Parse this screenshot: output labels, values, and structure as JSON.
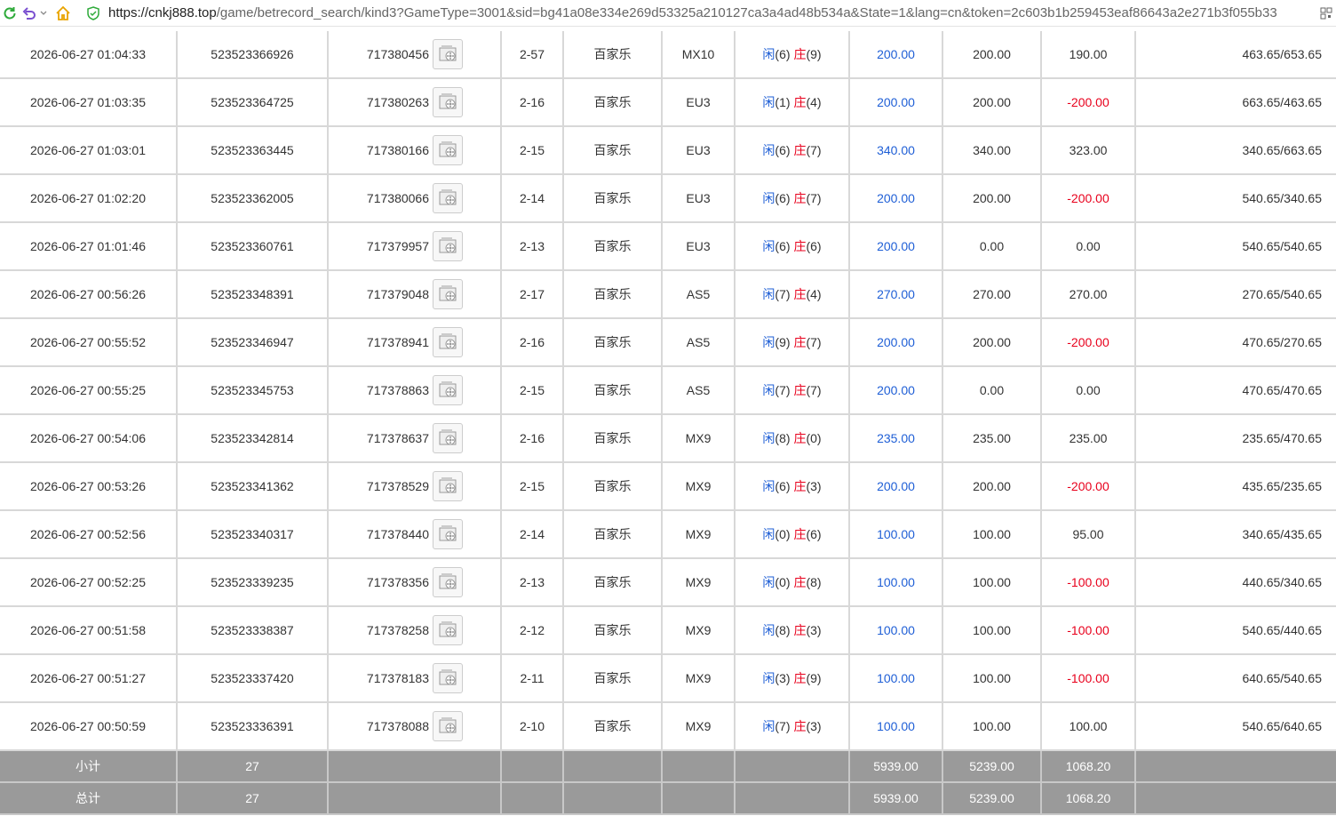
{
  "browser": {
    "url_host": "https://cnkj888.top",
    "url_path": "/game/betrecord_search/kind3?GameType=3001&sid=bg41a08e334e269d53325a210127ca3a4ad48b534a&State=1&lang=cn&token=2c603b1b259453eaf86643a2e271b3f055b33"
  },
  "rows": [
    {
      "time": "2026-06-27 01:04:33",
      "bet_id": "523523366926",
      "round": "717380456",
      "shoe": "2-57",
      "game": "百家乐",
      "table": "MX10",
      "player_label": "闲",
      "player_score": "(6)",
      "banker_label": "庄",
      "banker_score": "(9)",
      "bet": "200.00",
      "valid": "200.00",
      "win": "190.00",
      "win_color": "normal",
      "balance": "463.65/653.65"
    },
    {
      "time": "2026-06-27 01:03:35",
      "bet_id": "523523364725",
      "round": "717380263",
      "shoe": "2-16",
      "game": "百家乐",
      "table": "EU3",
      "player_label": "闲",
      "player_score": "(1)",
      "banker_label": "庄",
      "banker_score": "(4)",
      "bet": "200.00",
      "valid": "200.00",
      "win": "-200.00",
      "win_color": "red",
      "balance": "663.65/463.65"
    },
    {
      "time": "2026-06-27 01:03:01",
      "bet_id": "523523363445",
      "round": "717380166",
      "shoe": "2-15",
      "game": "百家乐",
      "table": "EU3",
      "player_label": "闲",
      "player_score": "(6)",
      "banker_label": "庄",
      "banker_score": "(7)",
      "bet": "340.00",
      "valid": "340.00",
      "win": "323.00",
      "win_color": "normal",
      "balance": "340.65/663.65"
    },
    {
      "time": "2026-06-27 01:02:20",
      "bet_id": "523523362005",
      "round": "717380066",
      "shoe": "2-14",
      "game": "百家乐",
      "table": "EU3",
      "player_label": "闲",
      "player_score": "(6)",
      "banker_label": "庄",
      "banker_score": "(7)",
      "bet": "200.00",
      "valid": "200.00",
      "win": "-200.00",
      "win_color": "red",
      "balance": "540.65/340.65"
    },
    {
      "time": "2026-06-27 01:01:46",
      "bet_id": "523523360761",
      "round": "717379957",
      "shoe": "2-13",
      "game": "百家乐",
      "table": "EU3",
      "player_label": "闲",
      "player_score": "(6)",
      "banker_label": "庄",
      "banker_score": "(6)",
      "bet": "200.00",
      "valid": "0.00",
      "win": "0.00",
      "win_color": "normal",
      "balance": "540.65/540.65"
    },
    {
      "time": "2026-06-27 00:56:26",
      "bet_id": "523523348391",
      "round": "717379048",
      "shoe": "2-17",
      "game": "百家乐",
      "table": "AS5",
      "player_label": "闲",
      "player_score": "(7)",
      "banker_label": "庄",
      "banker_score": "(4)",
      "bet": "270.00",
      "valid": "270.00",
      "win": "270.00",
      "win_color": "normal",
      "balance": "270.65/540.65"
    },
    {
      "time": "2026-06-27 00:55:52",
      "bet_id": "523523346947",
      "round": "717378941",
      "shoe": "2-16",
      "game": "百家乐",
      "table": "AS5",
      "player_label": "闲",
      "player_score": "(9)",
      "banker_label": "庄",
      "banker_score": "(7)",
      "bet": "200.00",
      "valid": "200.00",
      "win": "-200.00",
      "win_color": "red",
      "balance": "470.65/270.65"
    },
    {
      "time": "2026-06-27 00:55:25",
      "bet_id": "523523345753",
      "round": "717378863",
      "shoe": "2-15",
      "game": "百家乐",
      "table": "AS5",
      "player_label": "闲",
      "player_score": "(7)",
      "banker_label": "庄",
      "banker_score": "(7)",
      "bet": "200.00",
      "valid": "0.00",
      "win": "0.00",
      "win_color": "normal",
      "balance": "470.65/470.65"
    },
    {
      "time": "2026-06-27 00:54:06",
      "bet_id": "523523342814",
      "round": "717378637",
      "shoe": "2-16",
      "game": "百家乐",
      "table": "MX9",
      "player_label": "闲",
      "player_score": "(8)",
      "banker_label": "庄",
      "banker_score": "(0)",
      "bet": "235.00",
      "valid": "235.00",
      "win": "235.00",
      "win_color": "normal",
      "balance": "235.65/470.65"
    },
    {
      "time": "2026-06-27 00:53:26",
      "bet_id": "523523341362",
      "round": "717378529",
      "shoe": "2-15",
      "game": "百家乐",
      "table": "MX9",
      "player_label": "闲",
      "player_score": "(6)",
      "banker_label": "庄",
      "banker_score": "(3)",
      "bet": "200.00",
      "valid": "200.00",
      "win": "-200.00",
      "win_color": "red",
      "balance": "435.65/235.65"
    },
    {
      "time": "2026-06-27 00:52:56",
      "bet_id": "523523340317",
      "round": "717378440",
      "shoe": "2-14",
      "game": "百家乐",
      "table": "MX9",
      "player_label": "闲",
      "player_score": "(0)",
      "banker_label": "庄",
      "banker_score": "(6)",
      "bet": "100.00",
      "valid": "100.00",
      "win": "95.00",
      "win_color": "normal",
      "balance": "340.65/435.65"
    },
    {
      "time": "2026-06-27 00:52:25",
      "bet_id": "523523339235",
      "round": "717378356",
      "shoe": "2-13",
      "game": "百家乐",
      "table": "MX9",
      "player_label": "闲",
      "player_score": "(0)",
      "banker_label": "庄",
      "banker_score": "(8)",
      "bet": "100.00",
      "valid": "100.00",
      "win": "-100.00",
      "win_color": "red",
      "balance": "440.65/340.65"
    },
    {
      "time": "2026-06-27 00:51:58",
      "bet_id": "523523338387",
      "round": "717378258",
      "shoe": "2-12",
      "game": "百家乐",
      "table": "MX9",
      "player_label": "闲",
      "player_score": "(8)",
      "banker_label": "庄",
      "banker_score": "(3)",
      "bet": "100.00",
      "valid": "100.00",
      "win": "-100.00",
      "win_color": "red",
      "balance": "540.65/440.65"
    },
    {
      "time": "2026-06-27 00:51:27",
      "bet_id": "523523337420",
      "round": "717378183",
      "shoe": "2-11",
      "game": "百家乐",
      "table": "MX9",
      "player_label": "闲",
      "player_score": "(3)",
      "banker_label": "庄",
      "banker_score": "(9)",
      "bet": "100.00",
      "valid": "100.00",
      "win": "-100.00",
      "win_color": "red",
      "balance": "640.65/540.65"
    },
    {
      "time": "2026-06-27 00:50:59",
      "bet_id": "523523336391",
      "round": "717378088",
      "shoe": "2-10",
      "game": "百家乐",
      "table": "MX9",
      "player_label": "闲",
      "player_score": "(7)",
      "banker_label": "庄",
      "banker_score": "(3)",
      "bet": "100.00",
      "valid": "100.00",
      "win": "100.00",
      "win_color": "normal",
      "balance": "540.65/640.65"
    }
  ],
  "subtotal": {
    "label": "小计",
    "count": "27",
    "bet": "5939.00",
    "valid": "5239.00",
    "win": "1068.20"
  },
  "total": {
    "label": "总计",
    "count": "27",
    "bet": "5939.00",
    "valid": "5239.00",
    "win": "1068.20"
  },
  "colors": {
    "blue": "#1f5fd6",
    "red": "#e8001c",
    "summary_bg": "#9a9a9a"
  }
}
